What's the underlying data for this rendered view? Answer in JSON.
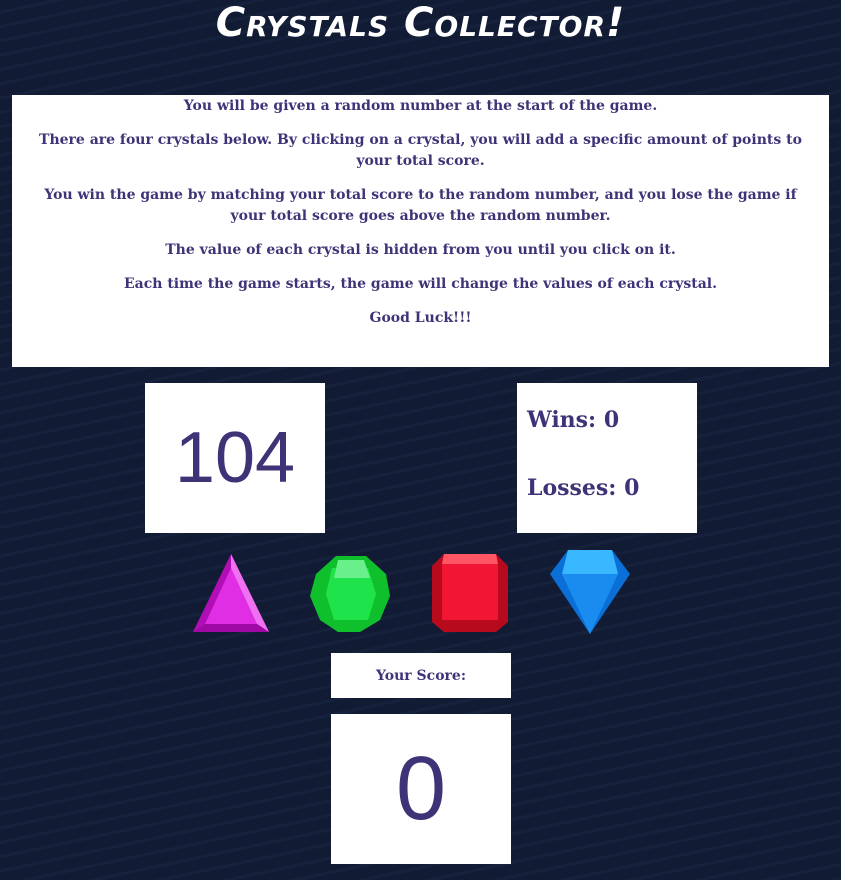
{
  "title": "Crystals Collector!",
  "instructions": [
    "You will be given a random number at the start of the game.",
    "There are four crystals below. By clicking on a crystal, you will add a specific amount of points to your total score.",
    "You win the game by matching your total score to the random number, and you lose the game if your total score goes above the random number.",
    "The value of each crystal is hidden from you until you click on it.",
    "Each time the game starts, the game will change the values of each crystal.",
    "Good Luck!!!"
  ],
  "target_number": "104",
  "wins_label": "Wins: 0",
  "losses_label": "Losses: 0",
  "crystals": [
    {
      "icon": "pink-triangle-crystal-icon",
      "color": "#d21fd6"
    },
    {
      "icon": "green-crystal-icon",
      "color": "#17d93d"
    },
    {
      "icon": "red-crystal-icon",
      "color": "#f01634"
    },
    {
      "icon": "blue-diamond-crystal-icon",
      "color": "#1a8cf0"
    }
  ],
  "score_label": "Your Score:",
  "score": "0"
}
